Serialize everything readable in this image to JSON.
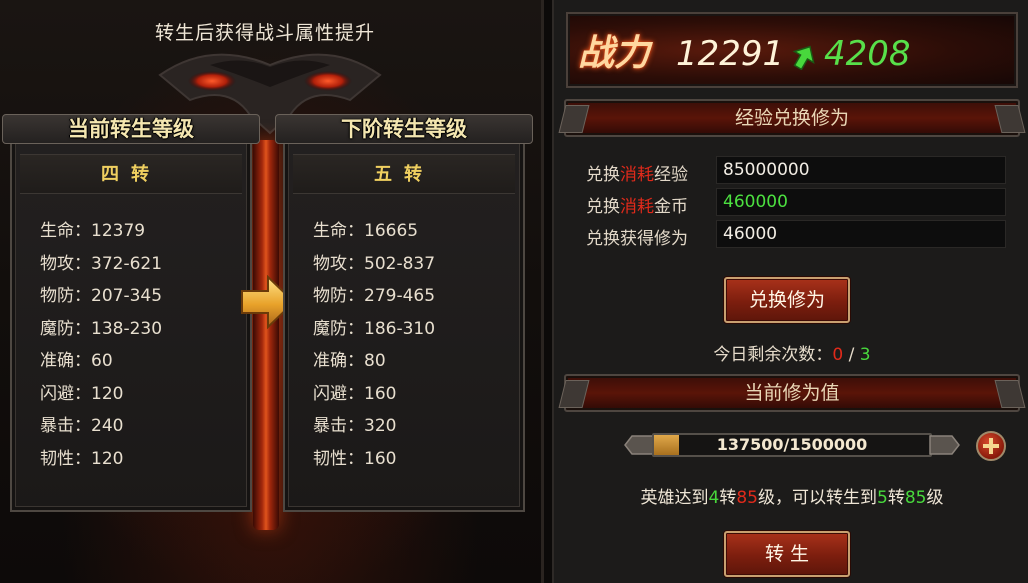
{
  "left": {
    "title": "转生后获得战斗属性提升",
    "current": {
      "header": "当前转生等级",
      "rank": "四转",
      "stats": [
        "生命：12379",
        "物攻：372-621",
        "物防：207-345",
        "魔防：138-230",
        "准确：60",
        "闪避：120",
        "暴击：240",
        "韧性：120"
      ]
    },
    "next": {
      "header": "下阶转生等级",
      "rank": "五转",
      "stats": [
        "生命：16665",
        "物攻：502-837",
        "物防：279-465",
        "魔防：186-310",
        "准确：80",
        "闪避：160",
        "暴击：320",
        "韧性：160"
      ]
    }
  },
  "right": {
    "power": {
      "label": "战力",
      "value": "12291",
      "gain": "4208"
    },
    "exchange": {
      "title": "经验兑换修为",
      "rows": [
        {
          "prefix": "兑换",
          "highlight": "消耗",
          "suffix": "经验",
          "value": "85000000"
        },
        {
          "prefix": "兑换",
          "highlight": "消耗",
          "suffix": "金币",
          "value": "460000"
        },
        {
          "prefix": "兑换获得修为",
          "highlight": "",
          "suffix": "",
          "value": "46000"
        }
      ],
      "button": "兑换修为",
      "remaining_label": "今日剩余次数：",
      "remaining_used": "0",
      "remaining_sep": " / ",
      "remaining_total": "3"
    },
    "xiuwei": {
      "title": "当前修为值",
      "progress_text": "137500/1500000",
      "progress_fraction": 0.0917,
      "condition": {
        "p1": "英雄达到",
        "level_a": "4",
        "p2": "转",
        "level_b": "85",
        "p3": "级，可以转生到",
        "level_c": "5",
        "p4": "转",
        "level_d": "85",
        "p5": "级"
      },
      "button": "转 生"
    },
    "colors": {
      "accent_red": "#e02a1a",
      "accent_green": "#48d83c",
      "gold": "#f0d060"
    }
  }
}
